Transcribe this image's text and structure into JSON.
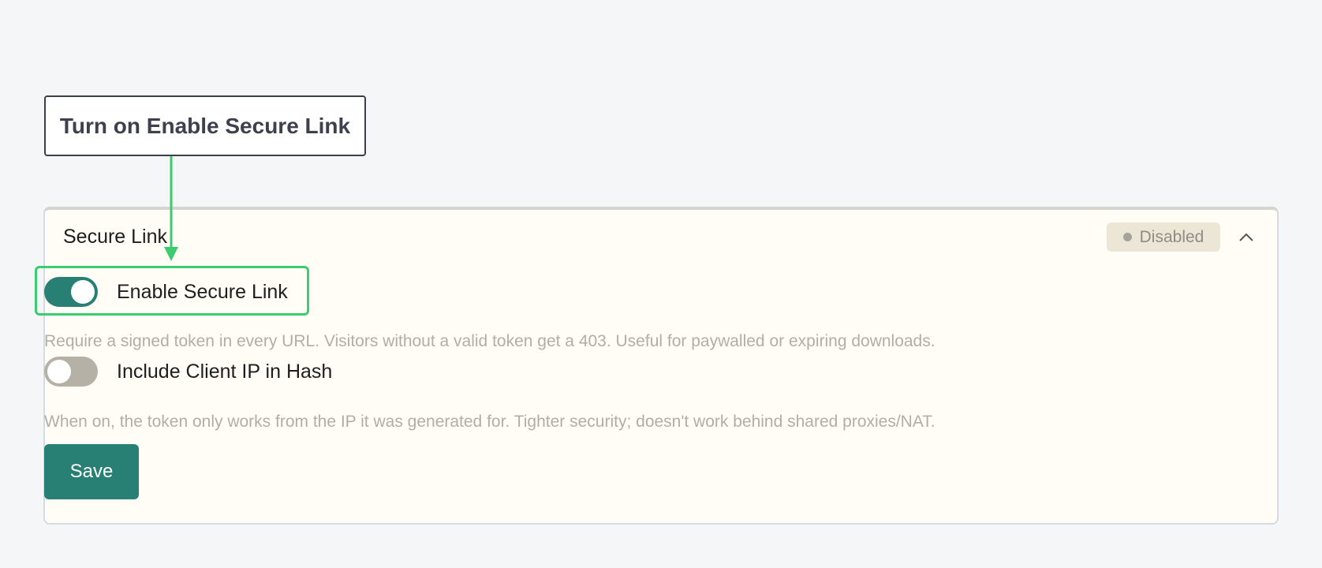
{
  "annotation": {
    "callout_text": "Turn on Enable Secure Link",
    "accent_color": "#3ccb6e"
  },
  "panel": {
    "title": "Secure Link",
    "status_badge": "Disabled",
    "collapse_icon": "chevron-up-icon"
  },
  "settings": [
    {
      "label": "Enable Secure Link",
      "enabled": true,
      "description": "Require a signed token in every URL. Visitors without a valid token get a 403. Useful for paywalled or expiring downloads."
    },
    {
      "label": "Include Client IP in Hash",
      "enabled": false,
      "description": "When on, the token only works from the IP it was generated for. Tighter security; doesn't work behind shared proxies/NAT."
    }
  ],
  "actions": {
    "save_label": "Save"
  },
  "colors": {
    "primary": "#287f74",
    "toggle_off": "#b5b1a6",
    "panel_background": "#fffdf5",
    "badge_background": "#ebe6d6"
  }
}
